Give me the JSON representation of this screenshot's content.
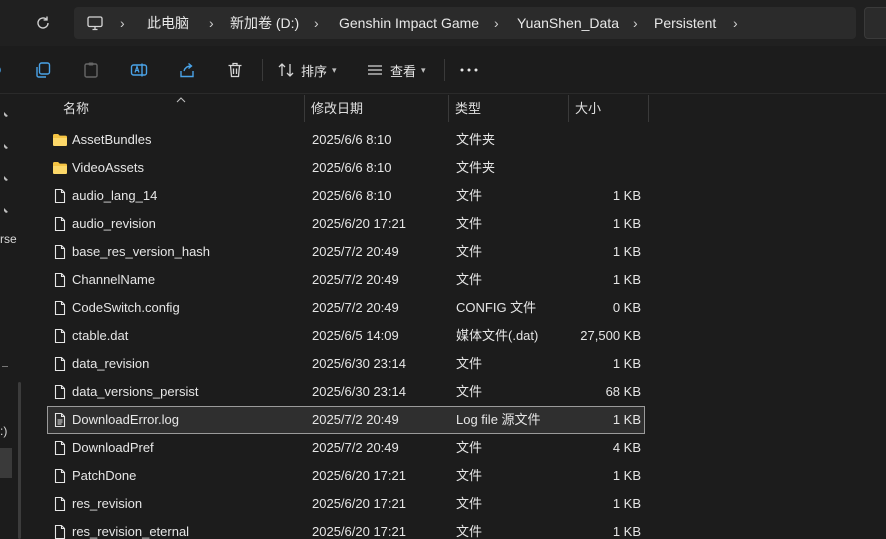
{
  "address": {
    "breadcrumbs": [
      "此电脑",
      "新加卷 (D:)",
      "Genshin Impact Game",
      "YuanShen_Data",
      "Persistent"
    ]
  },
  "toolbar": {
    "sort_label": "排序",
    "view_label": "查看"
  },
  "nav": {
    "fragments": [
      "rse",
      ":)"
    ]
  },
  "columns": {
    "name": "名称",
    "modified": "修改日期",
    "type": "类型",
    "size": "大小"
  },
  "files": [
    {
      "name": "AssetBundles",
      "modified": "2025/6/6 8:10",
      "type": "文件夹",
      "size": "",
      "icon": "folder-icon"
    },
    {
      "name": "VideoAssets",
      "modified": "2025/6/6 8:10",
      "type": "文件夹",
      "size": "",
      "icon": "folder-icon"
    },
    {
      "name": "audio_lang_14",
      "modified": "2025/6/6 8:10",
      "type": "文件",
      "size": "1 KB",
      "icon": "file-icon"
    },
    {
      "name": "audio_revision",
      "modified": "2025/6/20 17:21",
      "type": "文件",
      "size": "1 KB",
      "icon": "file-icon"
    },
    {
      "name": "base_res_version_hash",
      "modified": "2025/7/2 20:49",
      "type": "文件",
      "size": "1 KB",
      "icon": "file-icon"
    },
    {
      "name": "ChannelName",
      "modified": "2025/7/2 20:49",
      "type": "文件",
      "size": "1 KB",
      "icon": "file-icon"
    },
    {
      "name": "CodeSwitch.config",
      "modified": "2025/7/2 20:49",
      "type": "CONFIG 文件",
      "size": "0 KB",
      "icon": "file-icon"
    },
    {
      "name": "ctable.dat",
      "modified": "2025/6/5 14:09",
      "type": "媒体文件(.dat)",
      "size": "27,500 KB",
      "icon": "file-icon"
    },
    {
      "name": "data_revision",
      "modified": "2025/6/30 23:14",
      "type": "文件",
      "size": "1 KB",
      "icon": "file-icon"
    },
    {
      "name": "data_versions_persist",
      "modified": "2025/6/30 23:14",
      "type": "文件",
      "size": "68 KB",
      "icon": "file-icon"
    },
    {
      "name": "DownloadError.log",
      "modified": "2025/7/2 20:49",
      "type": "Log file 源文件",
      "size": "1 KB",
      "icon": "log-file-icon",
      "selected": true
    },
    {
      "name": "DownloadPref",
      "modified": "2025/7/2 20:49",
      "type": "文件",
      "size": "4 KB",
      "icon": "file-icon"
    },
    {
      "name": "PatchDone",
      "modified": "2025/6/20 17:21",
      "type": "文件",
      "size": "1 KB",
      "icon": "file-icon"
    },
    {
      "name": "res_revision",
      "modified": "2025/6/20 17:21",
      "type": "文件",
      "size": "1 KB",
      "icon": "file-icon"
    },
    {
      "name": "res_revision_eternal",
      "modified": "2025/6/20 17:21",
      "type": "文件",
      "size": "1 KB",
      "icon": "file-icon"
    }
  ],
  "colors": {
    "background": "#1c1c1c",
    "folder": "#f5c443",
    "selected_row": "#2f2f2f",
    "selected_border": "#9a9a9a"
  }
}
